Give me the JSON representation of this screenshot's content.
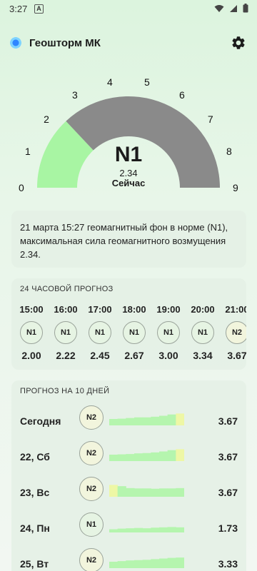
{
  "status_bar": {
    "time": "3:27",
    "badge": "A"
  },
  "app": {
    "title": "Геошторм МК"
  },
  "gauge": {
    "scale": [
      "0",
      "1",
      "2",
      "3",
      "4",
      "5",
      "6",
      "7",
      "8",
      "9"
    ],
    "level": "N1",
    "value": "2.34",
    "value_fraction": 0.26,
    "caption": "Сейчас",
    "fill_color": "#a8f5a3",
    "track_color": "#8a8a8a"
  },
  "message": {
    "text": "21 марта 15:27 геомагнитный фон в норме (N1), максимальная сила геомагнитного возмущения 2.34."
  },
  "hourly": {
    "title": "24 ЧАСОВОЙ ПРОГНОЗ",
    "items": [
      {
        "time": "15:00",
        "level": "N1",
        "value": "2.00"
      },
      {
        "time": "16:00",
        "level": "N1",
        "value": "2.22"
      },
      {
        "time": "17:00",
        "level": "N1",
        "value": "2.45"
      },
      {
        "time": "18:00",
        "level": "N1",
        "value": "2.67"
      },
      {
        "time": "19:00",
        "level": "N1",
        "value": "3.00"
      },
      {
        "time": "20:00",
        "level": "N1",
        "value": "3.34"
      },
      {
        "time": "21:00",
        "level": "N2",
        "value": "3.67"
      }
    ]
  },
  "daily": {
    "title": "ПРОГНОЗ НА 10 ДНЕЙ",
    "items": [
      {
        "day": "Сегодня",
        "level": "N2",
        "value": "3.67",
        "trend": [
          2.0,
          2.1,
          2.3,
          2.5,
          2.5,
          2.7,
          3.0,
          3.4,
          3.7
        ]
      },
      {
        "day": "22, Сб",
        "level": "N2",
        "value": "3.67",
        "trend": [
          2.0,
          2.1,
          2.2,
          2.4,
          2.5,
          2.7,
          3.0,
          3.4,
          3.7
        ]
      },
      {
        "day": "23, Вс",
        "level": "N2",
        "value": "3.67",
        "trend": [
          3.7,
          3.3,
          2.7,
          2.6,
          2.6,
          2.5,
          2.6,
          2.6,
          2.7
        ]
      },
      {
        "day": "24, Пн",
        "level": "N1",
        "value": "1.73",
        "trend": [
          1.0,
          1.2,
          1.3,
          1.4,
          1.3,
          1.5,
          1.6,
          1.7,
          1.6
        ]
      },
      {
        "day": "25, Вт",
        "level": "N2",
        "value": "3.33",
        "trend": [
          2.0,
          2.2,
          2.4,
          2.5,
          2.6,
          2.8,
          3.0,
          3.2,
          3.3
        ]
      }
    ]
  }
}
